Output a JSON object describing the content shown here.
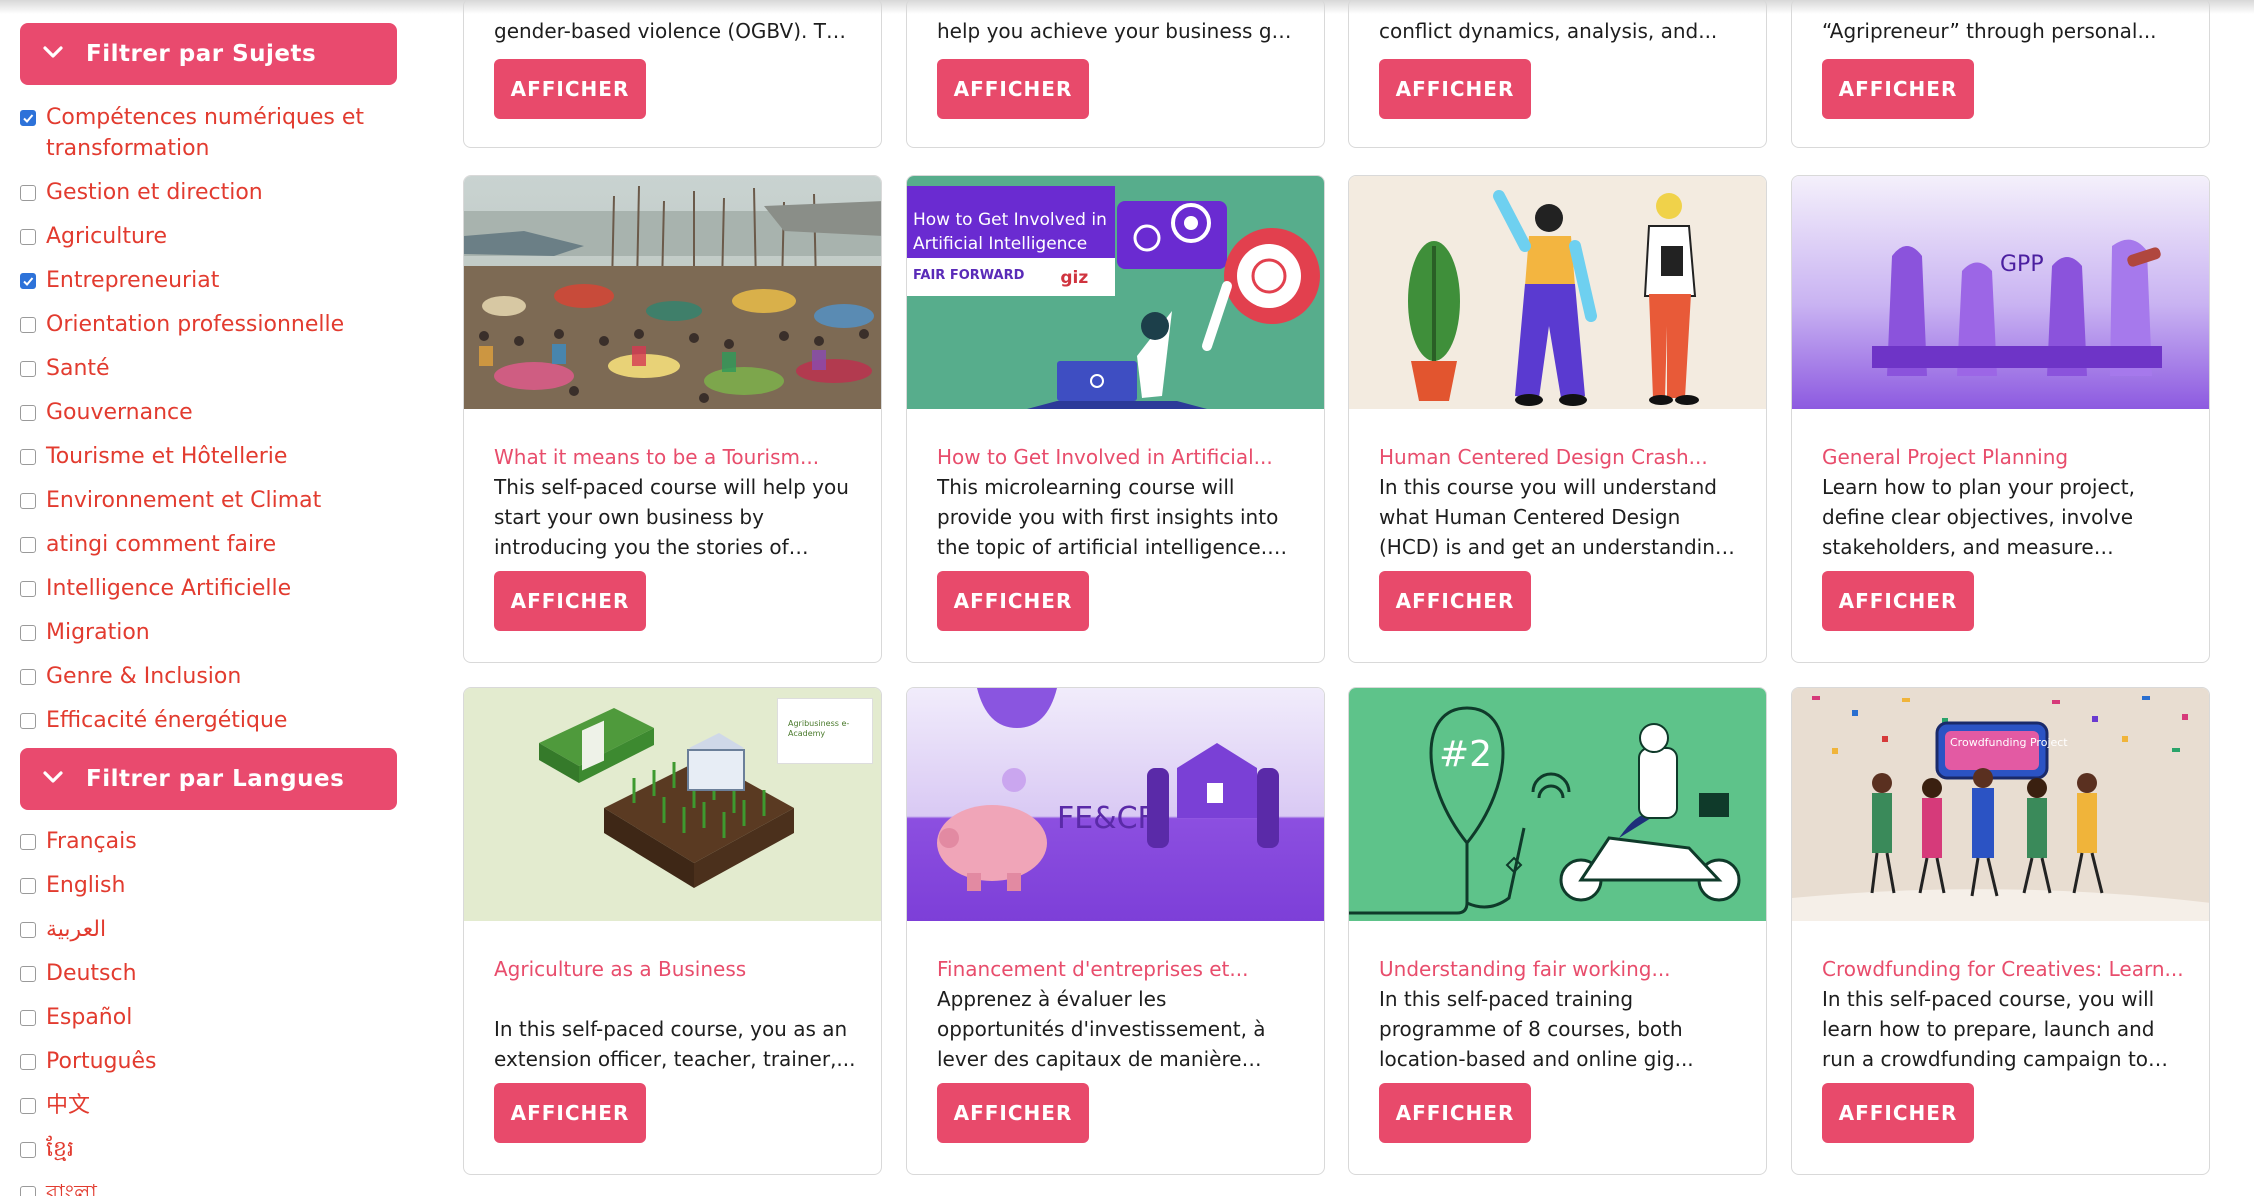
{
  "sidebar": {
    "subjects_header": "Filtrer par Sujets",
    "subjects": [
      {
        "label": "Compétences numériques et transformation",
        "checked": true
      },
      {
        "label": "Gestion et direction",
        "checked": false
      },
      {
        "label": "Agriculture",
        "checked": false
      },
      {
        "label": "Entrepreneuriat",
        "checked": true
      },
      {
        "label": "Orientation professionnelle",
        "checked": false
      },
      {
        "label": "Santé",
        "checked": false
      },
      {
        "label": "Gouvernance",
        "checked": false
      },
      {
        "label": "Tourisme et Hôtellerie",
        "checked": false
      },
      {
        "label": "Environnement et Climat",
        "checked": false
      },
      {
        "label": "atingi comment faire",
        "checked": false
      },
      {
        "label": "Intelligence Artificielle",
        "checked": false
      },
      {
        "label": "Migration",
        "checked": false
      },
      {
        "label": "Genre & Inclusion",
        "checked": false
      },
      {
        "label": "Efficacité énergétique",
        "checked": false
      }
    ],
    "languages_header": "Filtrer par Langues",
    "languages": [
      {
        "label": "Français",
        "checked": false
      },
      {
        "label": "English",
        "checked": false
      },
      {
        "label": "العربية",
        "checked": false
      },
      {
        "label": "Deutsch",
        "checked": false
      },
      {
        "label": "Español",
        "checked": false
      },
      {
        "label": "Português",
        "checked": false
      },
      {
        "label": "中文",
        "checked": false
      },
      {
        "label": "ខ្មែរ",
        "checked": false
      },
      {
        "label": "বাংলা",
        "checked": false
      }
    ]
  },
  "button_label": "AFFICHER",
  "top_cards": [
    {
      "desc": "gender-based violence (OGBV).  Thi..."
    },
    {
      "desc": "help you achieve your business goal..."
    },
    {
      "desc": "conflict dynamics, analysis, and..."
    },
    {
      "desc": "“Agripreneur” through personal..."
    }
  ],
  "cards": [
    {
      "title": "What it means to be a Tourism...",
      "desc": "This self-paced course will help you start your own business by introducing you the stories of three..."
    },
    {
      "title": "How to Get Involved in Artificial...",
      "desc": "This microlearning course will provide you with first insights into the topic of artificial intelligence. The...",
      "image_title": "How to Get Involved in Artificial Intelligence",
      "image_logo": "FAIR FORWARD",
      "image_logo2": "giz"
    },
    {
      "title": "Human Centered Design Crash...",
      "desc": "In this course you will understand what Human Centered Design (HCD) is and get an understanding of how..."
    },
    {
      "title": "General Project Planning",
      "desc": "Learn how to plan your project, define clear objectives, involve stakeholders, and measure project...",
      "image_text": "GPP"
    },
    {
      "title": "Agriculture as a Business",
      "desc": "In this self-paced course, you as an extension officer, teacher, trainer,...",
      "image_badge": "Agribusiness e-Academy"
    },
    {
      "title": "Financement d'entreprises et...",
      "desc": "Apprenez à évaluer les opportunités d'investissement, à lever des capitaux de manière efficace et à...",
      "image_text": "FE&CF"
    },
    {
      "title": "Understanding fair working...",
      "desc": "In this self-paced training programme of 8 courses, both location-based and online gig...",
      "image_text": "#2"
    },
    {
      "title": "Crowdfunding for Creatives: Learn...",
      "desc": "In this self-paced course, you will learn how to prepare, launch and run a crowdfunding campaign to fund...",
      "image_text": "Crowdfunding Project"
    }
  ]
}
